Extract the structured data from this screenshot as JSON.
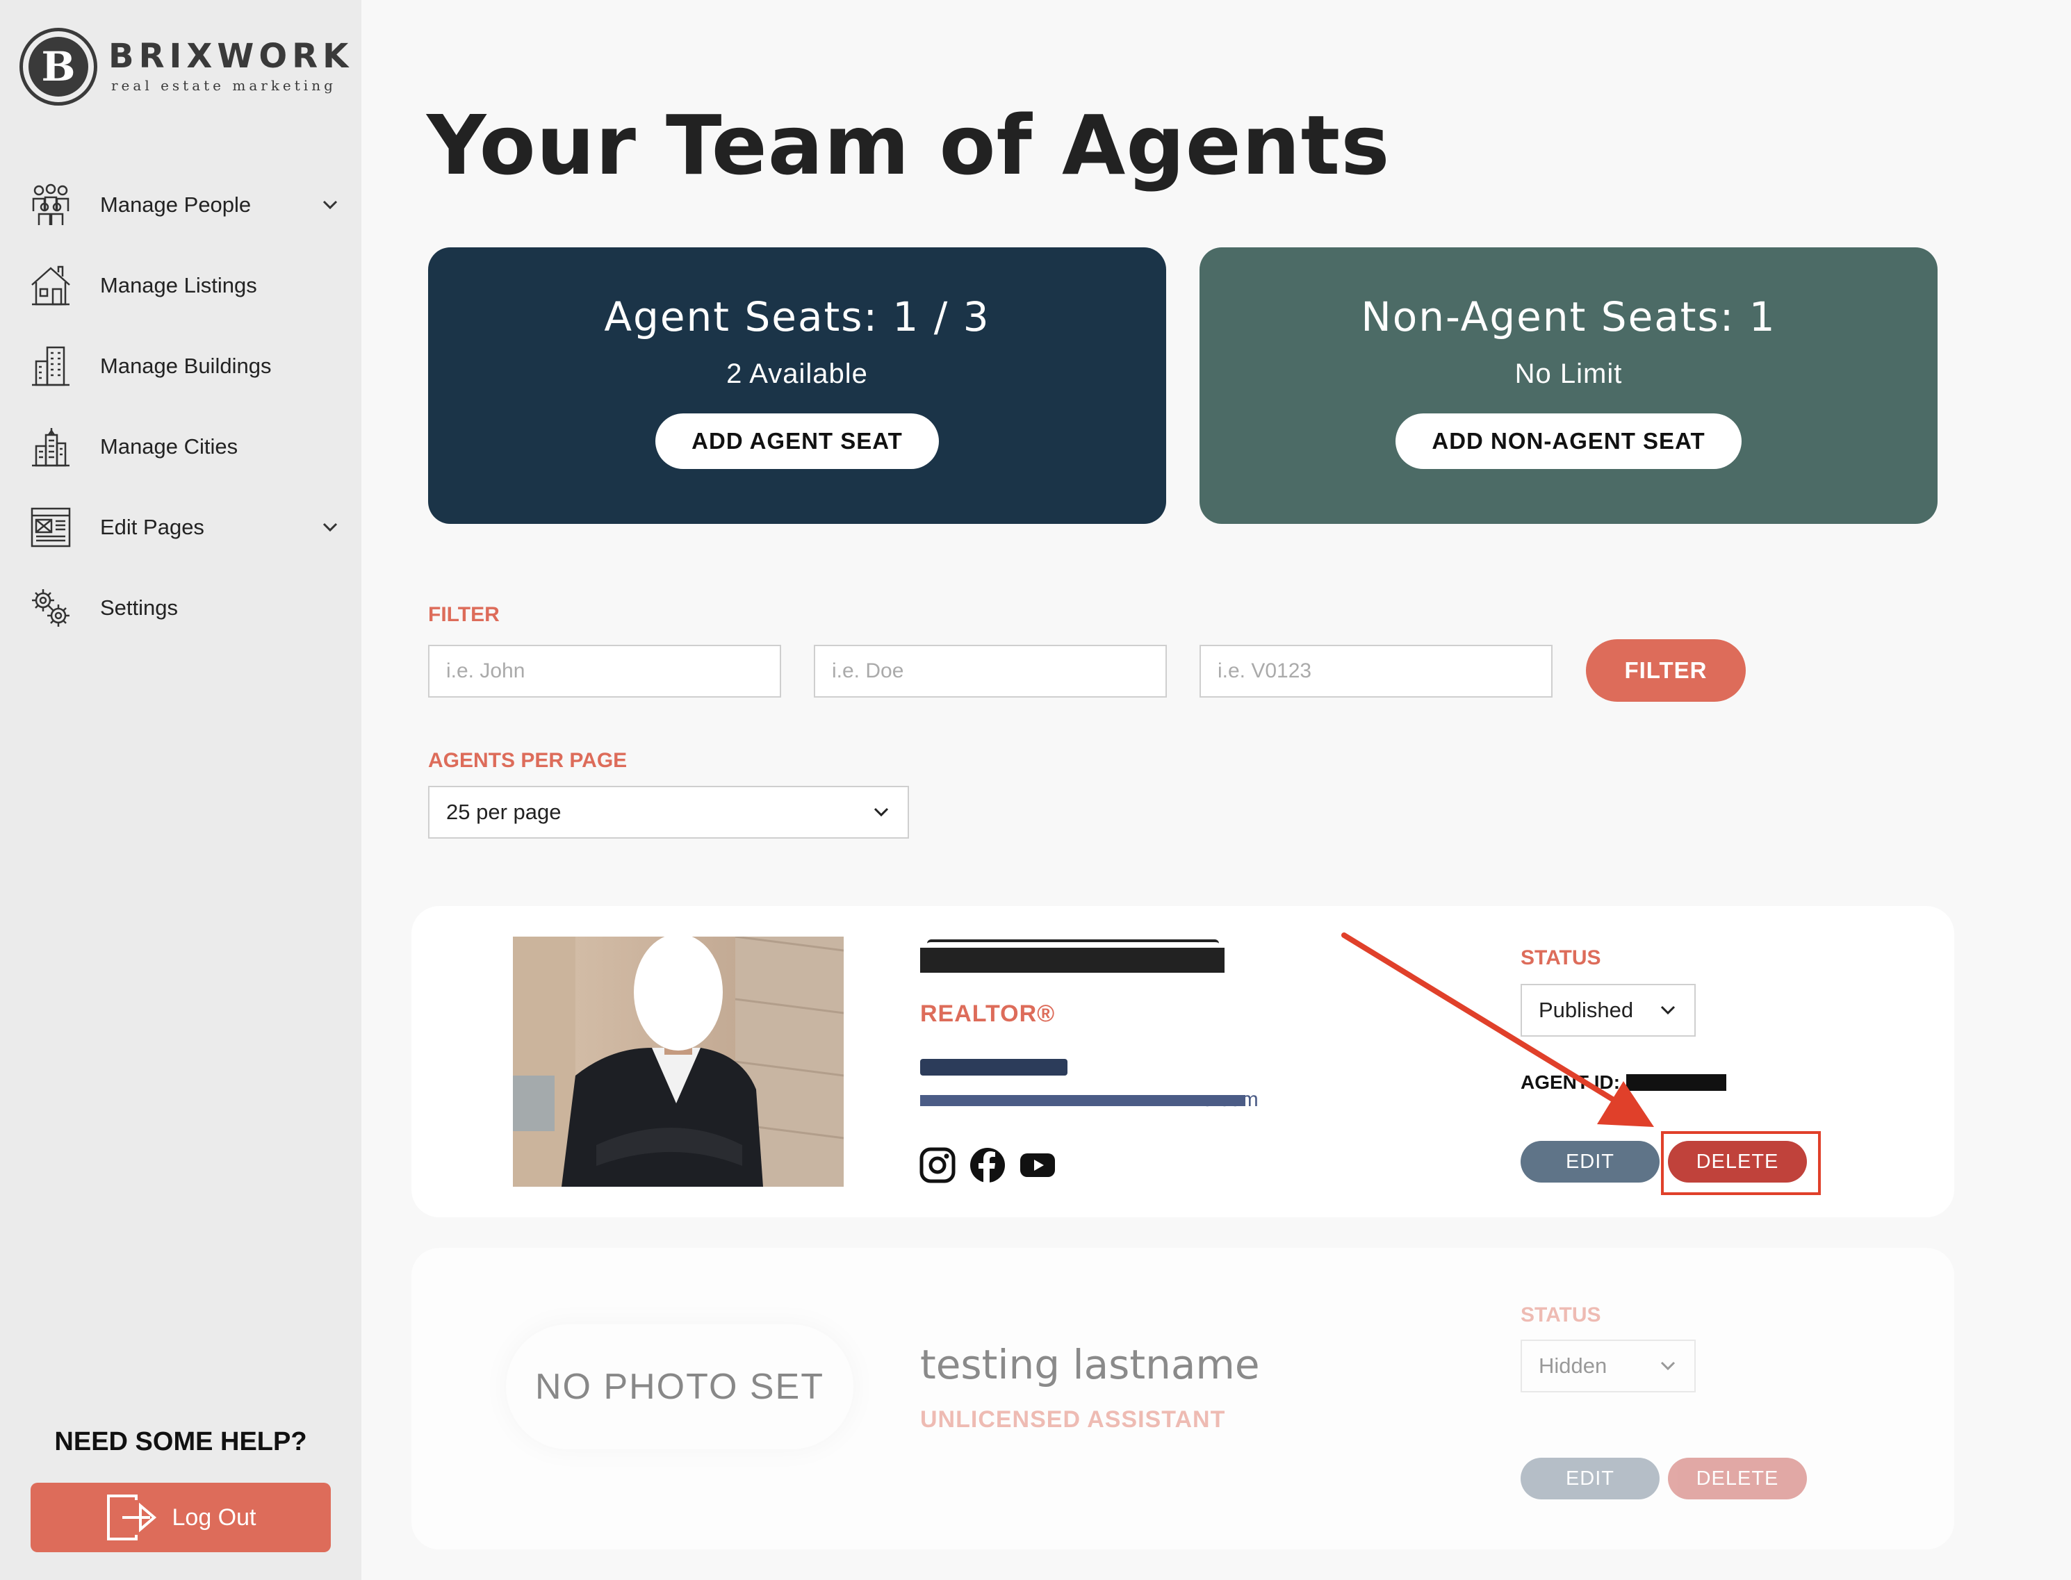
{
  "brand": {
    "name": "BRIXWORK",
    "tagline": "real estate marketing",
    "mark": "B"
  },
  "sidebar": {
    "items": [
      {
        "label": "Manage People",
        "icon": "people-icon",
        "has_submenu": true
      },
      {
        "label": "Manage Listings",
        "icon": "house-icon",
        "has_submenu": false
      },
      {
        "label": "Manage Buildings",
        "icon": "building-icon",
        "has_submenu": false
      },
      {
        "label": "Manage Cities",
        "icon": "city-icon",
        "has_submenu": false
      },
      {
        "label": "Edit Pages",
        "icon": "page-layout-icon",
        "has_submenu": true
      },
      {
        "label": "Settings",
        "icon": "gears-icon",
        "has_submenu": false
      }
    ],
    "help_title": "NEED SOME HELP?",
    "logout_label": "Log Out"
  },
  "main": {
    "title": "Your Team of Agents",
    "seats": {
      "agent": {
        "title": "Agent Seats: 1 / 3",
        "subtitle": "2 Available",
        "button": "ADD AGENT SEAT"
      },
      "non_agent": {
        "title": "Non-Agent Seats: 1",
        "subtitle": "No Limit",
        "button": "ADD NON-AGENT SEAT"
      }
    },
    "filter": {
      "label": "FILTER",
      "first_name_placeholder": "i.e. John",
      "last_name_placeholder": "i.e. Doe",
      "id_placeholder": "i.e. V0123",
      "button": "FILTER"
    },
    "per_page": {
      "label": "AGENTS PER PAGE",
      "value": "25 per page"
    }
  },
  "agents": [
    {
      "name": "",
      "role": "REALTOR®",
      "email_suffix": "e.com",
      "status_label": "STATUS",
      "status": "Published",
      "agent_id_label": "AGENT ID:",
      "edit_label": "EDIT",
      "delete_label": "DELETE",
      "socials": [
        "instagram-icon",
        "facebook-icon",
        "youtube-icon"
      ]
    },
    {
      "photo_placeholder": "NO PHOTO SET",
      "name": "testing lastname",
      "role": "UNLICENSED ASSISTANT",
      "status_label": "STATUS",
      "status": "Hidden",
      "edit_label": "EDIT",
      "delete_label": "DELETE"
    }
  ],
  "colors": {
    "accent": "#dd6c5a",
    "agent_card": "#1b3448",
    "non_agent_card": "#4c6b66",
    "edit": "#5f7488",
    "delete": "#c0423b",
    "annotation": "#e0402a"
  }
}
